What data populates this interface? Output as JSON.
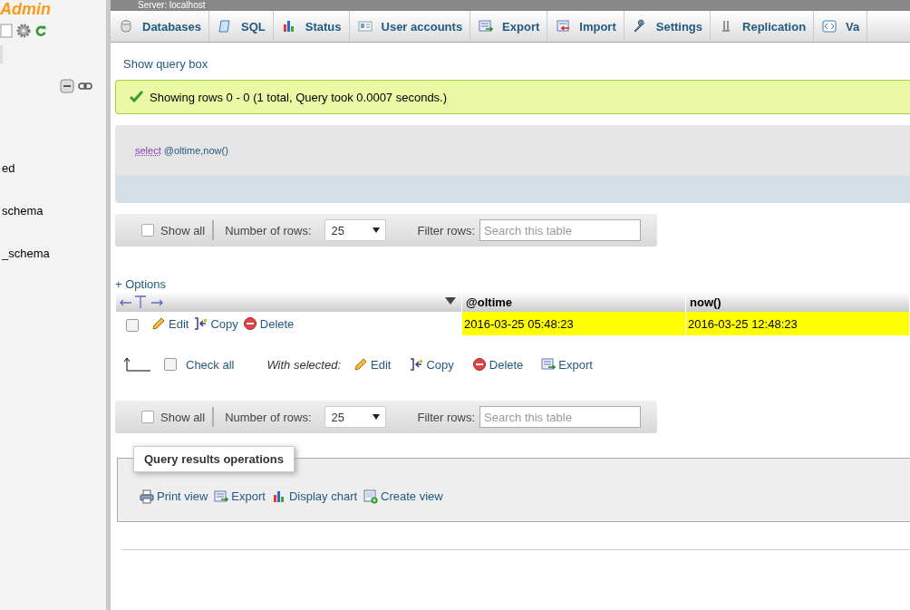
{
  "sidebar": {
    "logo": "Admin",
    "items": [
      {
        "label": "ed"
      },
      {
        "label": "schema"
      },
      {
        "label": "_schema"
      }
    ]
  },
  "breadcrumb": "Server: localhost",
  "tabs": [
    {
      "label": "Databases",
      "selected": false
    },
    {
      "label": "SQL",
      "selected": false
    },
    {
      "label": "Status",
      "selected": false
    },
    {
      "label": "User accounts",
      "selected": false
    },
    {
      "label": "Export",
      "selected": false
    },
    {
      "label": "Import",
      "selected": false
    },
    {
      "label": "Settings",
      "selected": false
    },
    {
      "label": "Replication",
      "selected": false
    },
    {
      "label": "Va",
      "selected": false
    }
  ],
  "show_query_box": "Show query box",
  "success_message": "Showing rows 0 - 0 (1 total, Query took 0.0007 seconds.)",
  "query": {
    "keyword": "select",
    "rest": "@oltime,now()"
  },
  "navigation_bars": [
    {
      "show_all": "Show all",
      "show_all_checked": false,
      "rows_label": "Number of rows:",
      "rows_value": "25",
      "filter_label": "Filter rows:",
      "filter_placeholder": "Search this table"
    },
    {
      "show_all": "Show all",
      "show_all_checked": false,
      "rows_label": "Number of rows:",
      "rows_value": "25",
      "filter_label": "Filter rows:",
      "filter_placeholder": "Search this table"
    }
  ],
  "options_link": "+ Options",
  "table": {
    "columns": [
      "@oltime",
      "now()"
    ],
    "rows": [
      {
        "checked": false,
        "highlighted": true,
        "actions": [
          "Edit",
          "Copy",
          "Delete"
        ],
        "cells": [
          "2016-03-25 05:48:23",
          "2016-03-25 12:48:23"
        ]
      }
    ]
  },
  "bulk_actions": {
    "check_all": "Check all",
    "checked": false,
    "with_selected": "With selected:",
    "actions": [
      "Edit",
      "Copy",
      "Delete",
      "Export"
    ]
  },
  "operations": {
    "title": "Query results operations",
    "links": [
      "Print view",
      "Export",
      "Display chart",
      "Create view"
    ]
  }
}
